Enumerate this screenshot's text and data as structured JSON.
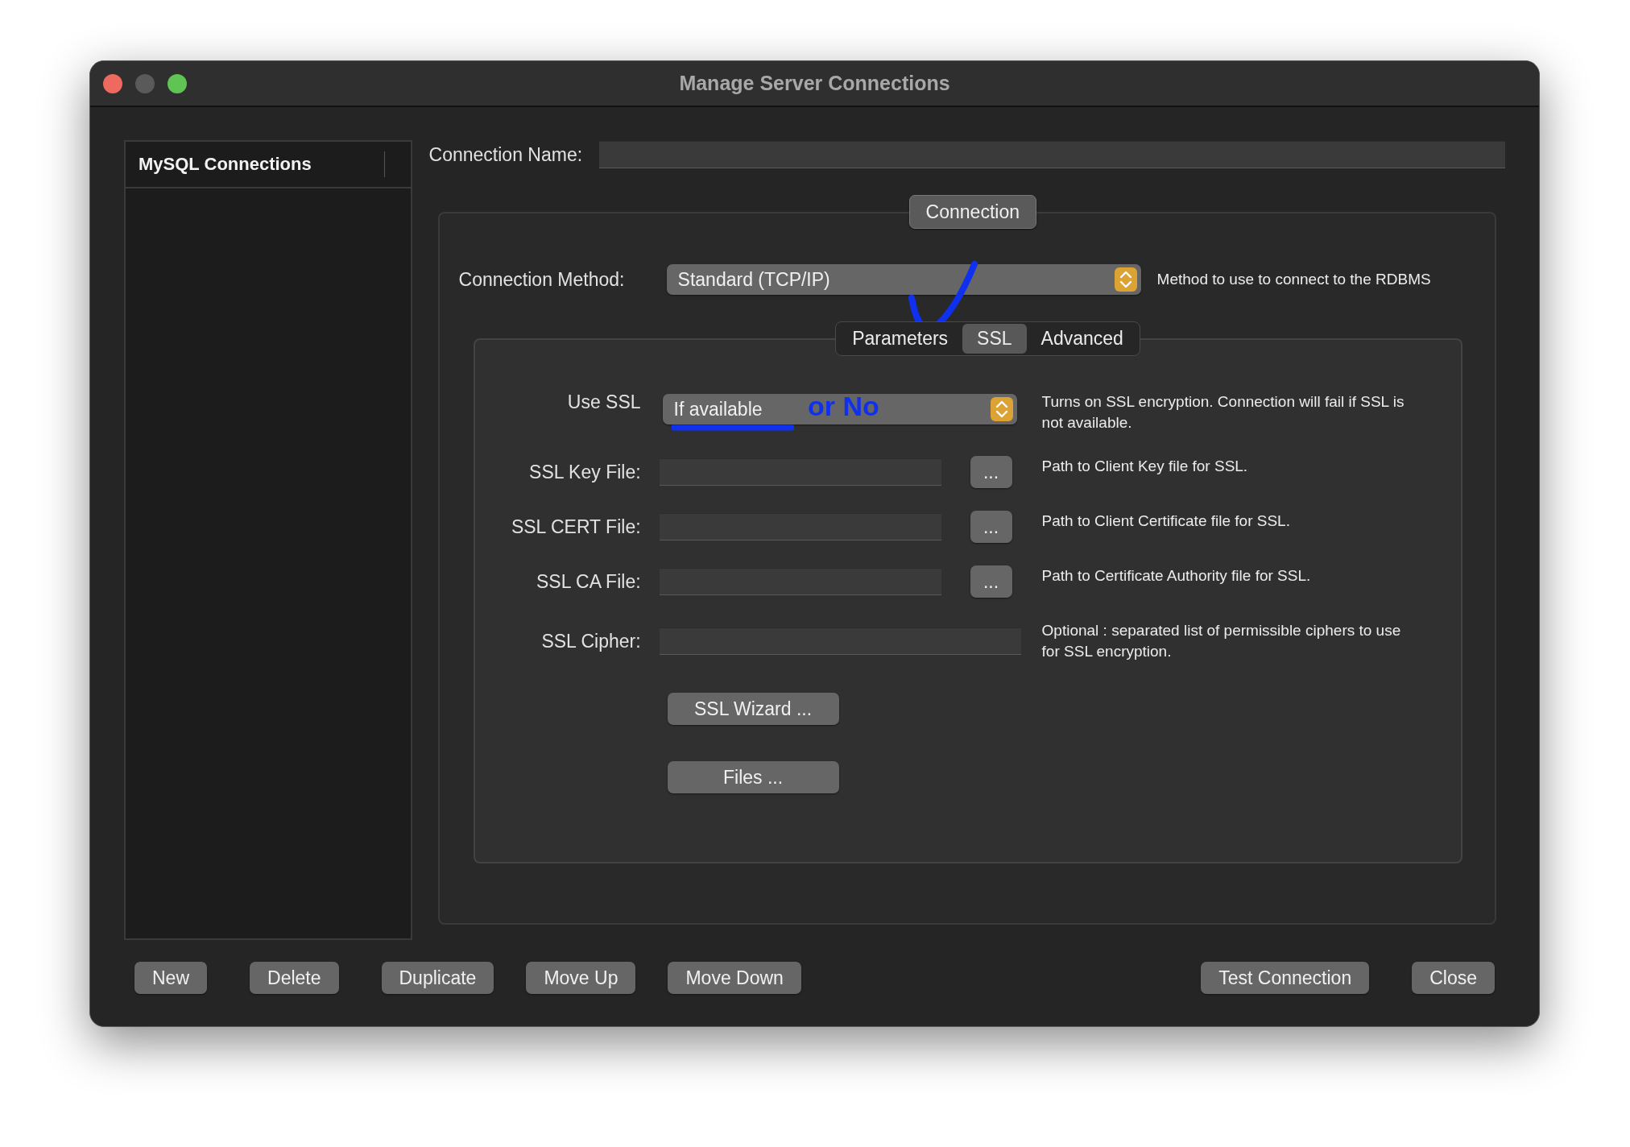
{
  "window": {
    "title": "Manage Server Connections"
  },
  "sidebar": {
    "header": "MySQL Connections"
  },
  "connection_name": {
    "label": "Connection Name:"
  },
  "group": {
    "tab": "Connection"
  },
  "connection_method": {
    "label": "Connection Method:",
    "value": "Standard (TCP/IP)",
    "description": "Method to use to connect to the RDBMS"
  },
  "tabs": [
    {
      "label": "Parameters",
      "selected": false
    },
    {
      "label": "SSL",
      "selected": true
    },
    {
      "label": "Advanced",
      "selected": false
    }
  ],
  "ssl_fields": [
    {
      "kind": "dropdown",
      "label": "Use SSL",
      "value": "If available",
      "description": "Turns on SSL encryption. Connection will fail if SSL is not available."
    },
    {
      "kind": "file",
      "label": "SSL Key File:",
      "button": "...",
      "description": "Path to Client Key file for SSL."
    },
    {
      "kind": "file",
      "label": "SSL CERT File:",
      "button": "...",
      "description": "Path to Client Certificate file for SSL."
    },
    {
      "kind": "file",
      "label": "SSL CA File:",
      "button": "...",
      "description": "Path to Certificate Authority file for SSL."
    },
    {
      "kind": "text",
      "label": "SSL Cipher:",
      "description": "Optional : separated list of permissible ciphers to use for SSL encryption."
    }
  ],
  "panel_buttons": [
    "SSL Wizard ...",
    "Files ..."
  ],
  "buttons_left": [
    "New",
    "Delete",
    "Duplicate",
    "Move Up",
    "Move Down"
  ],
  "buttons_right": [
    "Test Connection",
    "Close"
  ],
  "annotations": [
    {
      "kind": "checkmark"
    },
    {
      "kind": "text",
      "text": "or No"
    },
    {
      "kind": "underline"
    }
  ]
}
